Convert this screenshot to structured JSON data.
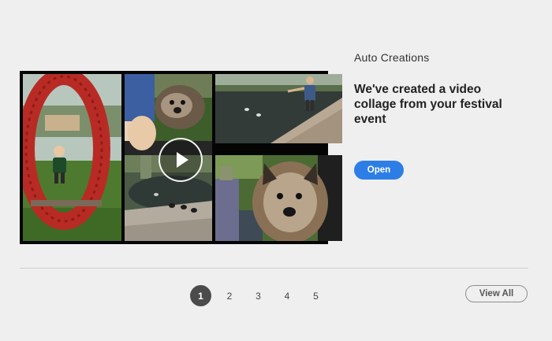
{
  "section": {
    "eyebrow": "Auto Creations",
    "headline": "We've created a video collage from your festival event",
    "open_label": "Open"
  },
  "collage": {
    "play_icon": "play-icon",
    "tiles": [
      "boy-in-red-ring-photo",
      "dog-held-in-arms-photo",
      "boy-by-duck-pond-photo",
      "ducks-on-pond-photo",
      "fluffy-dog-portrait-photo"
    ]
  },
  "pager": {
    "pages": [
      "1",
      "2",
      "3",
      "4",
      "5"
    ],
    "active_page": "1"
  },
  "view_all_label": "View All",
  "colors": {
    "background": "#efefef",
    "accent": "#2c7ee6",
    "active_page": "#4b4b4b",
    "divider": "#cfcfcf"
  }
}
